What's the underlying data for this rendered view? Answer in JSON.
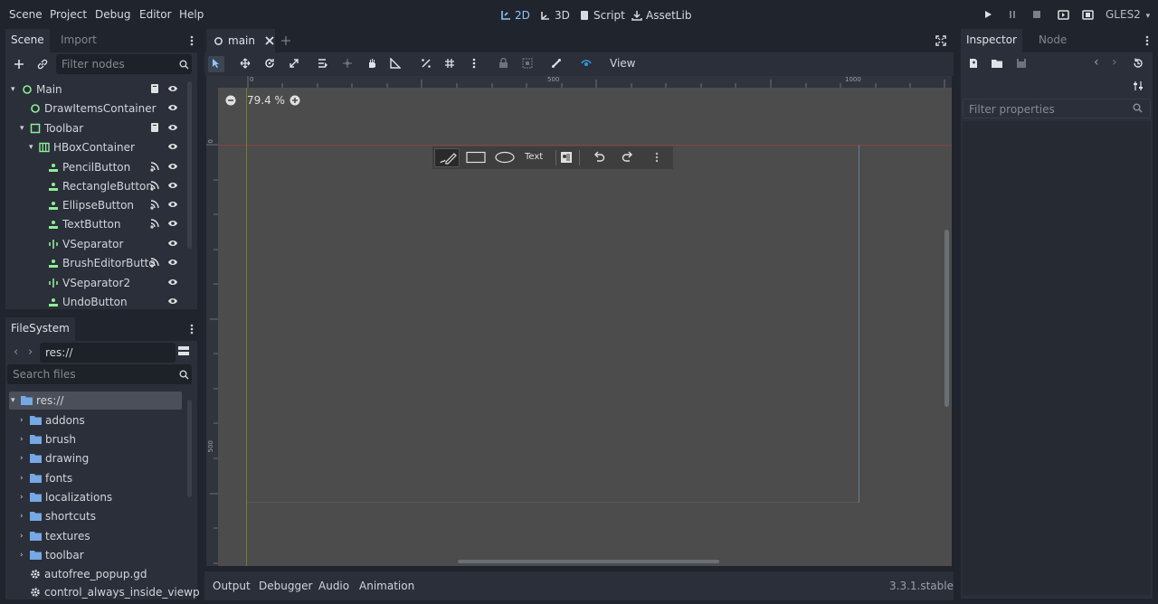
{
  "menu": [
    "Scene",
    "Project",
    "Debug",
    "Editor",
    "Help"
  ],
  "workspaces": {
    "d2": "2D",
    "d3": "3D",
    "script": "Script",
    "assetlib": "AssetLib"
  },
  "renderer": "GLES2",
  "scene_panel": {
    "tabs": {
      "scene": "Scene",
      "import": "Import"
    },
    "filter_placeholder": "Filter nodes",
    "nodes": [
      {
        "label": "Main"
      },
      {
        "label": "DrawItemsContainer"
      },
      {
        "label": "Toolbar"
      },
      {
        "label": "HBoxContainer"
      },
      {
        "label": "PencilButton"
      },
      {
        "label": "RectangleButton"
      },
      {
        "label": "EllipseButton"
      },
      {
        "label": "TextButton"
      },
      {
        "label": "VSeparator"
      },
      {
        "label": "BrushEditorButto"
      },
      {
        "label": "VSeparator2"
      },
      {
        "label": "UndoButton"
      }
    ]
  },
  "filesystem": {
    "title": "FileSystem",
    "path": "res://",
    "search_placeholder": "Search files",
    "items": [
      {
        "label": "res://"
      },
      {
        "label": "addons"
      },
      {
        "label": "brush"
      },
      {
        "label": "drawing"
      },
      {
        "label": "fonts"
      },
      {
        "label": "localizations"
      },
      {
        "label": "shortcuts"
      },
      {
        "label": "textures"
      },
      {
        "label": "toolbar"
      },
      {
        "label": "autofree_popup.gd"
      },
      {
        "label": "control_always_inside_viewp"
      }
    ]
  },
  "editor": {
    "scene_tab": "main",
    "view_menu": "View",
    "zoom": "79.4 %",
    "ruler_labels": {
      "h0": "0",
      "h500": "500",
      "h1000": "1000",
      "v0": "0",
      "v500": "500"
    },
    "canvas_toolbar_text": "Text"
  },
  "bottom_panel": {
    "tabs": {
      "output": "Output",
      "debugger": "Debugger",
      "audio": "Audio",
      "animation": "Animation"
    },
    "version": "3.3.1.stable"
  },
  "inspector": {
    "tabs": {
      "inspector": "Inspector",
      "node": "Node"
    },
    "filter_placeholder": "Filter properties"
  },
  "colors": {
    "accent": "#8ec5ff",
    "node_green": "#8eef97",
    "folder_blue": "#76a8e6",
    "bg": "#20242c",
    "panel": "#2a2f39"
  }
}
